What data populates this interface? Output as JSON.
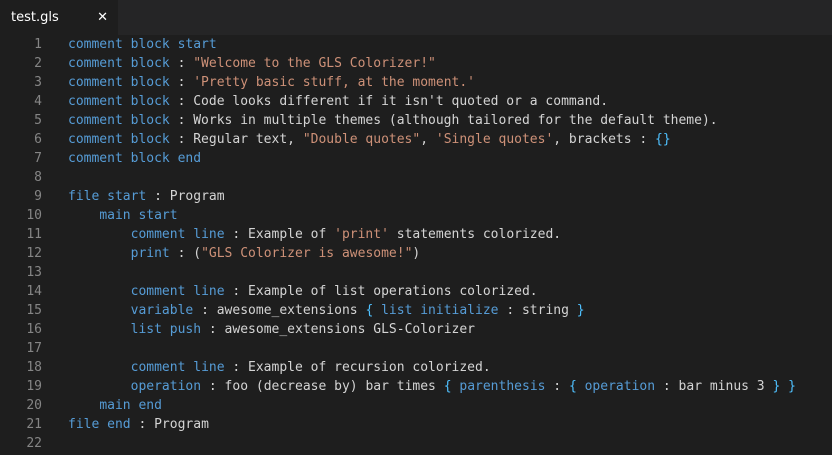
{
  "tab": {
    "label": "test.gls",
    "close_glyph": "✕"
  },
  "colors": {
    "background": "#1e1e1e",
    "tabbar": "#252526",
    "line_number": "#858585",
    "keyword": "#569cd6",
    "string": "#ce9178",
    "plain": "#d4d4d4",
    "brace": "#4fc1ff"
  },
  "lines": [
    {
      "n": "1",
      "tokens": [
        [
          "k",
          "comment block start"
        ]
      ]
    },
    {
      "n": "2",
      "tokens": [
        [
          "k",
          "comment block"
        ],
        [
          "p",
          " : "
        ],
        [
          "s",
          "\"Welcome to the GLS Colorizer!\""
        ]
      ]
    },
    {
      "n": "3",
      "tokens": [
        [
          "k",
          "comment block"
        ],
        [
          "p",
          " : "
        ],
        [
          "s",
          "'Pretty basic stuff, at the moment.'"
        ]
      ]
    },
    {
      "n": "4",
      "tokens": [
        [
          "k",
          "comment block"
        ],
        [
          "p",
          " : Code looks different if it isn't quoted or a command."
        ]
      ]
    },
    {
      "n": "5",
      "tokens": [
        [
          "k",
          "comment block"
        ],
        [
          "p",
          " : Works in multiple themes (although tailored for the default theme)."
        ]
      ]
    },
    {
      "n": "6",
      "tokens": [
        [
          "k",
          "comment block"
        ],
        [
          "p",
          " : Regular text, "
        ],
        [
          "s",
          "\"Double quotes\""
        ],
        [
          "p",
          ", "
        ],
        [
          "s",
          "'Single quotes'"
        ],
        [
          "p",
          ", brackets : "
        ],
        [
          "br",
          "{}"
        ]
      ]
    },
    {
      "n": "7",
      "tokens": [
        [
          "k",
          "comment block end"
        ]
      ]
    },
    {
      "n": "8",
      "tokens": []
    },
    {
      "n": "9",
      "tokens": [
        [
          "k",
          "file start"
        ],
        [
          "p",
          " : Program"
        ]
      ]
    },
    {
      "n": "10",
      "tokens": [
        [
          "p",
          "    "
        ],
        [
          "k",
          "main start"
        ]
      ]
    },
    {
      "n": "11",
      "tokens": [
        [
          "p",
          "        "
        ],
        [
          "k",
          "comment line"
        ],
        [
          "p",
          " : Example of "
        ],
        [
          "s",
          "'print'"
        ],
        [
          "p",
          " statements colorized."
        ]
      ]
    },
    {
      "n": "12",
      "tokens": [
        [
          "p",
          "        "
        ],
        [
          "k",
          "print"
        ],
        [
          "p",
          " : ("
        ],
        [
          "s",
          "\"GLS Colorizer is awesome!\""
        ],
        [
          "p",
          ")"
        ]
      ]
    },
    {
      "n": "13",
      "tokens": []
    },
    {
      "n": "14",
      "tokens": [
        [
          "p",
          "        "
        ],
        [
          "k",
          "comment line"
        ],
        [
          "p",
          " : Example of list operations colorized."
        ]
      ]
    },
    {
      "n": "15",
      "tokens": [
        [
          "p",
          "        "
        ],
        [
          "k",
          "variable"
        ],
        [
          "p",
          " : awesome_extensions "
        ],
        [
          "br",
          "{"
        ],
        [
          "p",
          " "
        ],
        [
          "k",
          "list initialize"
        ],
        [
          "p",
          " : string "
        ],
        [
          "br",
          "}"
        ]
      ]
    },
    {
      "n": "16",
      "tokens": [
        [
          "p",
          "        "
        ],
        [
          "k",
          "list push"
        ],
        [
          "p",
          " : awesome_extensions GLS-Colorizer"
        ]
      ]
    },
    {
      "n": "17",
      "tokens": []
    },
    {
      "n": "18",
      "tokens": [
        [
          "p",
          "        "
        ],
        [
          "k",
          "comment line"
        ],
        [
          "p",
          " : Example of recursion colorized."
        ]
      ]
    },
    {
      "n": "19",
      "tokens": [
        [
          "p",
          "        "
        ],
        [
          "k",
          "operation"
        ],
        [
          "p",
          " : foo (decrease by) bar times "
        ],
        [
          "br",
          "{"
        ],
        [
          "p",
          " "
        ],
        [
          "k",
          "parenthesis"
        ],
        [
          "p",
          " : "
        ],
        [
          "br",
          "{"
        ],
        [
          "p",
          " "
        ],
        [
          "k",
          "operation"
        ],
        [
          "p",
          " : bar minus 3 "
        ],
        [
          "br",
          "}"
        ],
        [
          "p",
          " "
        ],
        [
          "br",
          "}"
        ]
      ]
    },
    {
      "n": "20",
      "tokens": [
        [
          "p",
          "    "
        ],
        [
          "k",
          "main end"
        ]
      ]
    },
    {
      "n": "21",
      "tokens": [
        [
          "k",
          "file end"
        ],
        [
          "p",
          " : Program"
        ]
      ]
    },
    {
      "n": "22",
      "tokens": []
    }
  ]
}
